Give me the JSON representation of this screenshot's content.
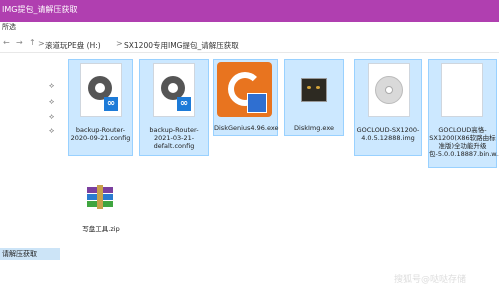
{
  "window": {
    "title": "IMG提包_请解压获取"
  },
  "toolbar": {
    "label": "所选"
  },
  "breadcrumb": {
    "items": [
      "滚道玩PE盘 (H:)",
      "SX1200专用IMG提包_请解压获取"
    ],
    "sep": ">"
  },
  "sidebar": {
    "selected_label": "请解压获取"
  },
  "files": [
    {
      "name": "backup-Router-2020-09-21.config",
      "icon": "config-file-icon"
    },
    {
      "name": "backup-Router-2021-03-21-defalt.config",
      "icon": "config-file-icon"
    },
    {
      "name": "DiskGenius4.96.exe",
      "icon": "diskgenius-icon"
    },
    {
      "name": "DiskImg.exe",
      "icon": "cat-exe-icon"
    },
    {
      "name": "GOCLOUD-SX1200-4.0.5.12888.img",
      "icon": "disc-image-icon"
    },
    {
      "name": "GOCLOUD高恪-SX1200(X86软路由标准版)全功能升级包-5.0.0.18887.bin.w...",
      "icon": "document-icon"
    },
    {
      "name": "写盘工具.zip",
      "icon": "zip-archive-icon"
    }
  ],
  "watermark": "搜狐号@哒哒存储",
  "colors": {
    "titlebar": "#b03fb0",
    "selection": "#cce8ff",
    "selection_border": "#99d1ff"
  }
}
